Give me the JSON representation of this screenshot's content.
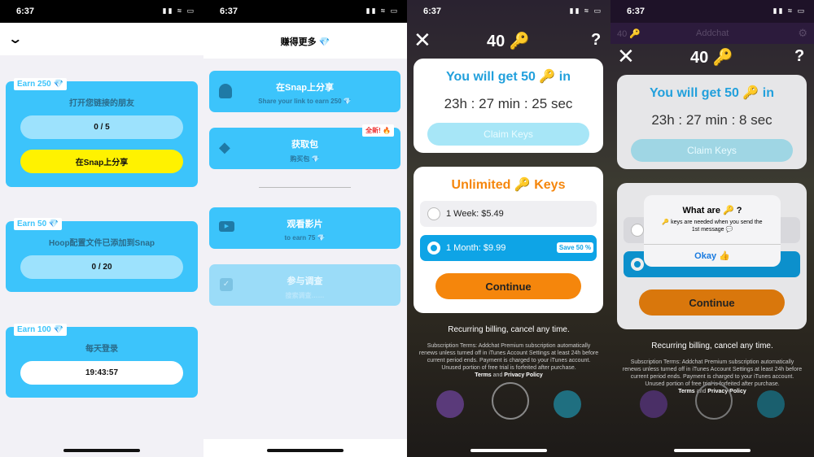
{
  "status": {
    "time": "6:37"
  },
  "panel1": {
    "tasks": [
      {
        "badge": "Earn 250 💎",
        "title": "打开您链接的朋友",
        "progress": "0 / 5",
        "button": "在Snap上分享"
      },
      {
        "badge": "Earn 50 💎",
        "title": "Hoop配置文件已添加到Snap",
        "progress": "0 / 20"
      },
      {
        "badge": "Earn 100 💎",
        "title": "每天登录",
        "countdown": "19:43:57"
      }
    ]
  },
  "panel2": {
    "title": "赚得更多 💎",
    "options": [
      {
        "icon": "snapchat-ghost-icon",
        "title": "在Snap上分享",
        "subtitle": "Share your link to earn 250 💎"
      },
      {
        "icon": "diamond-icon",
        "title": "获取包",
        "subtitle": "购买包 💎",
        "badge": "全新! 🔥"
      },
      {
        "icon": "video-play-icon",
        "title": "观看影片",
        "subtitle": "to earn 75 💎"
      },
      {
        "icon": "checkbox-icon",
        "title": "参与调查",
        "subtitle": "搜索调查……",
        "disabled": true
      }
    ]
  },
  "keys": {
    "count": "40 🔑",
    "help": "?",
    "get_title": "You will get 50 🔑 in",
    "claim": "Claim Keys",
    "unlimited": "Unlimited 🔑 Keys",
    "plans": [
      {
        "label": "1 Week: $5.49"
      },
      {
        "label": "1 Month: $9.99",
        "badge": "Save 50 %",
        "selected": true
      }
    ],
    "continue": "Continue",
    "recurring": "Recurring billing, cancel any time.",
    "terms": "Subscription Terms: Addchat Premium subscription automatically renews unless turned off in iTunes Account Settings at least 24h before current period ends. Payment is charged to your iTunes account. Unused portion of free trial is forfeited after purchase.",
    "terms_link": "Terms",
    "and": "and",
    "privacy_link": "Privacy Policy"
  },
  "panel3": {
    "timer": "23h : 27 min : 25 sec"
  },
  "panel4": {
    "timer": "23h : 27 min : 8 sec",
    "bg_header": {
      "count": "40 🔑",
      "title": "Addchat"
    },
    "dialog": {
      "title": "What are 🔑 ?",
      "body": "🔑 keys are needed when you send the 1st message 💬",
      "ok": "Okay 👍"
    }
  },
  "colors": {
    "accent_blue": "#3cc4fb",
    "yellow": "#fff200",
    "orange": "#f5860c",
    "key_blue": "#22a0dc"
  }
}
